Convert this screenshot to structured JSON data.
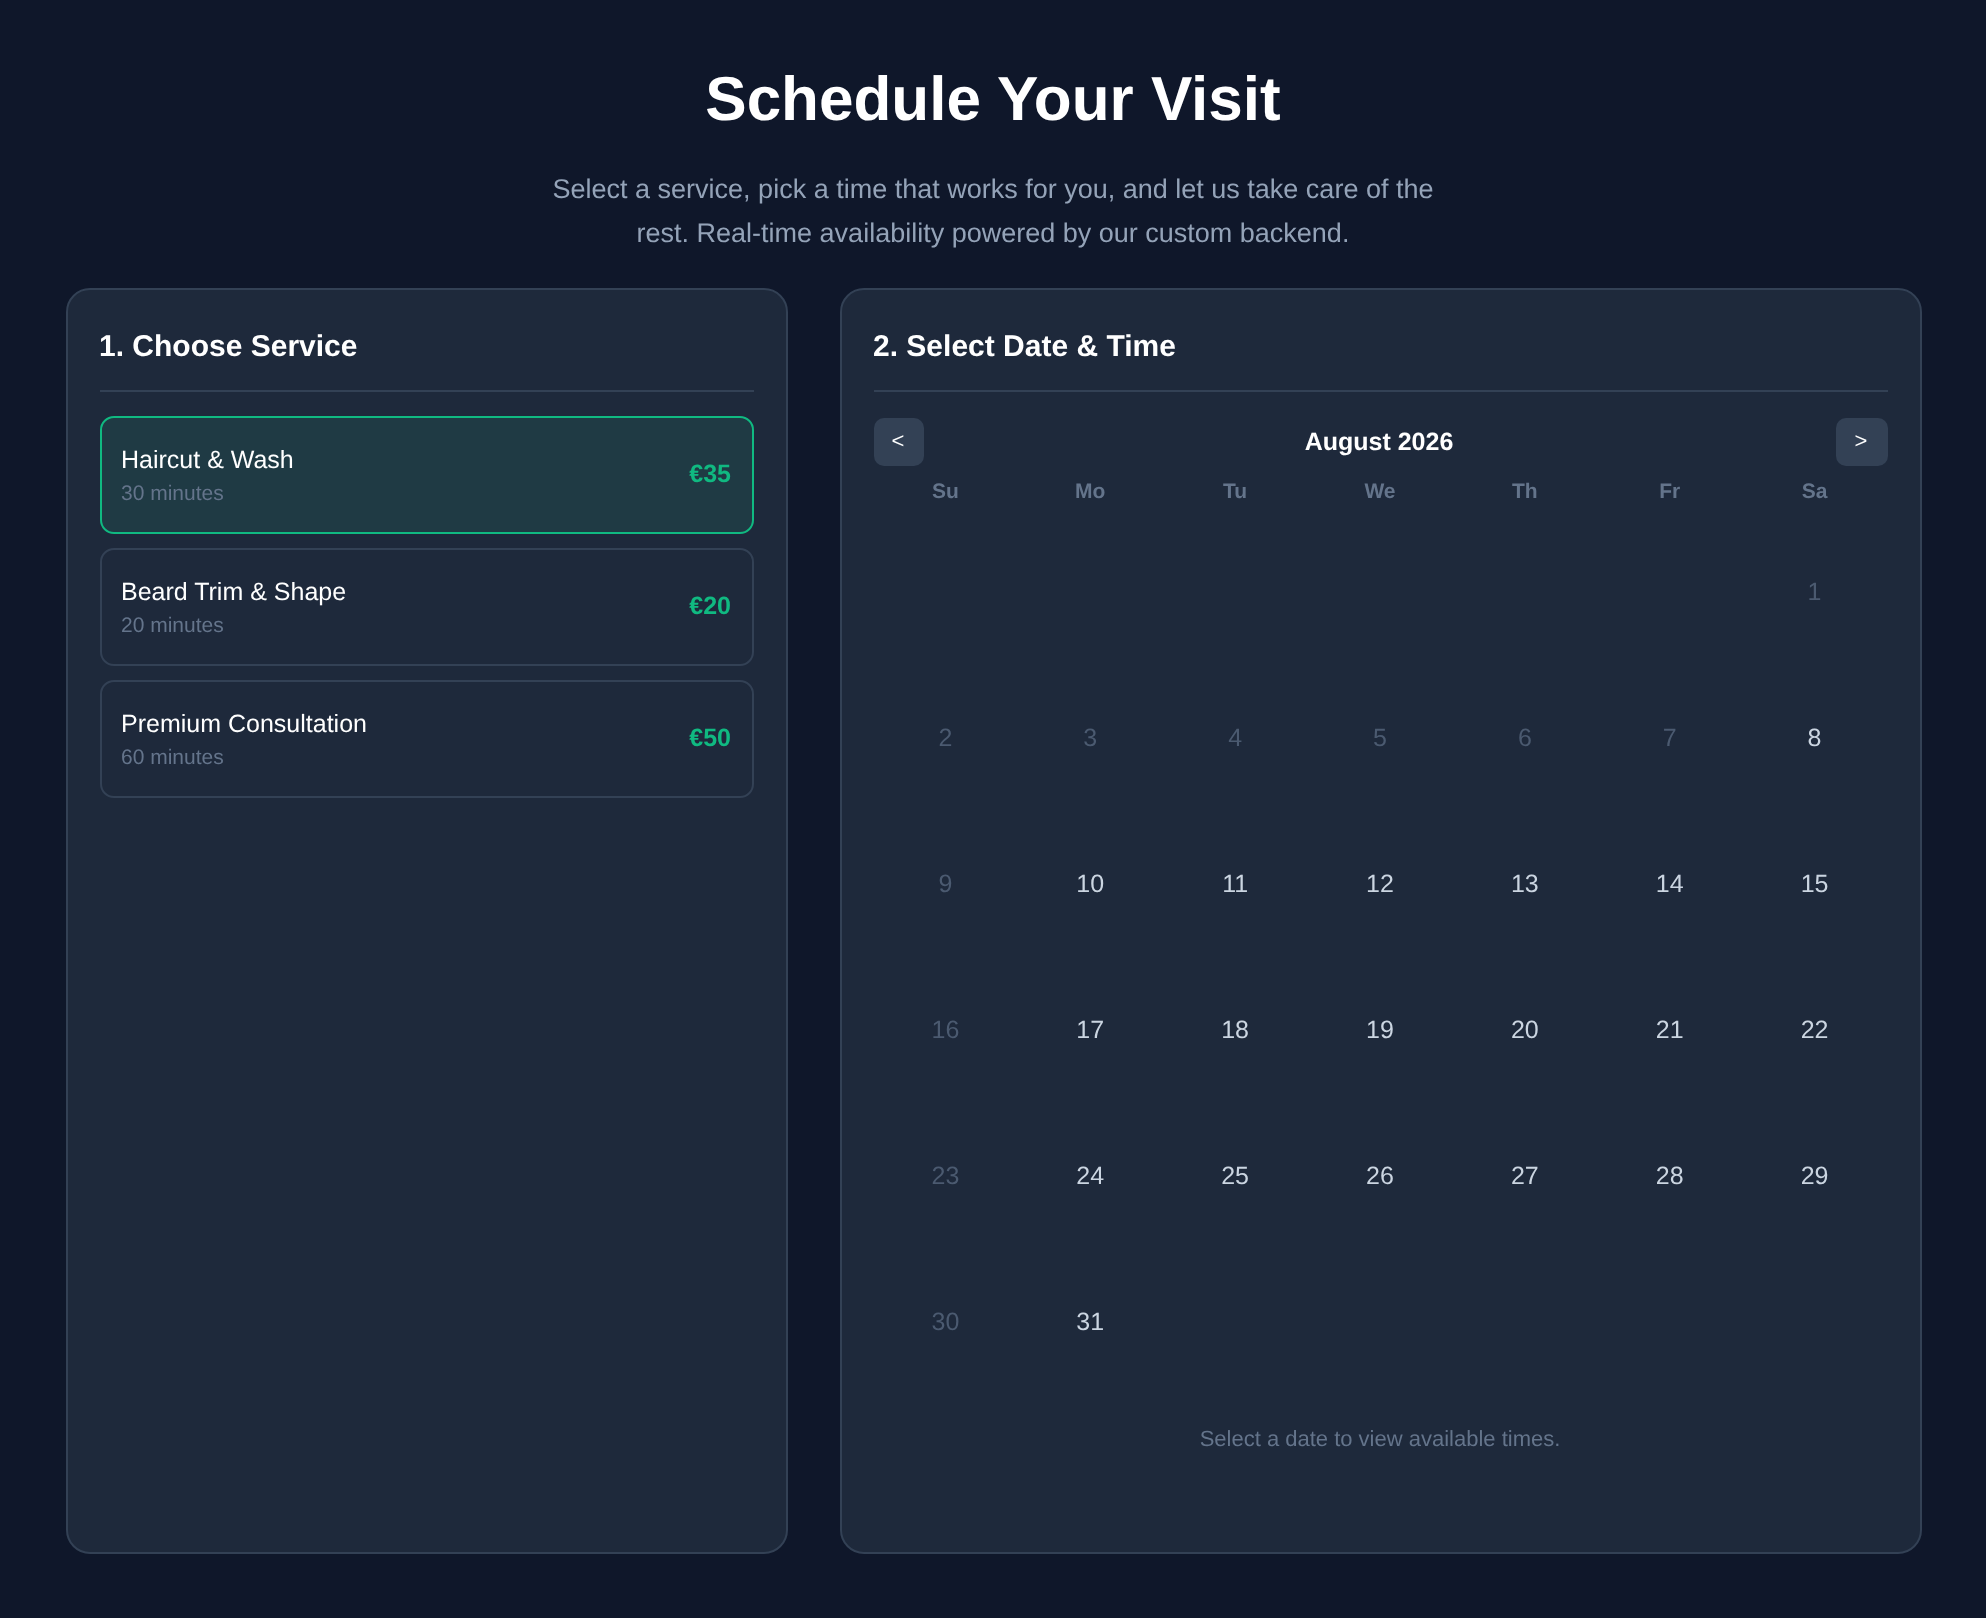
{
  "header": {
    "title": "Schedule Your Visit",
    "subtitle": "Select a service, pick a time that works for you, and let us take care of the rest. Real-time availability powered by our custom backend."
  },
  "services_panel": {
    "title": "1. Choose Service",
    "services": [
      {
        "name": "Haircut & Wash",
        "duration": "30 minutes",
        "price": "€35",
        "selected": true
      },
      {
        "name": "Beard Trim & Shape",
        "duration": "20 minutes",
        "price": "€20",
        "selected": false
      },
      {
        "name": "Premium Consultation",
        "duration": "60 minutes",
        "price": "€50",
        "selected": false
      }
    ]
  },
  "calendar_panel": {
    "title": "2. Select Date & Time",
    "prev": "<",
    "next": ">",
    "month": "August 2026",
    "weekdays": [
      "Su",
      "Mo",
      "Tu",
      "We",
      "Th",
      "Fr",
      "Sa"
    ],
    "weeks": [
      {
        "right_aligned": true,
        "days": [
          {
            "day": "1",
            "disabled": true
          }
        ]
      },
      {
        "right_aligned": false,
        "days": [
          {
            "day": "2",
            "disabled": true
          },
          {
            "day": "3",
            "disabled": true
          },
          {
            "day": "4",
            "disabled": true
          },
          {
            "day": "5",
            "disabled": true
          },
          {
            "day": "6",
            "disabled": true
          },
          {
            "day": "7",
            "disabled": true
          },
          {
            "day": "8",
            "disabled": false
          }
        ]
      },
      {
        "right_aligned": false,
        "days": [
          {
            "day": "9",
            "disabled": true
          },
          {
            "day": "10",
            "disabled": false
          },
          {
            "day": "11",
            "disabled": false
          },
          {
            "day": "12",
            "disabled": false
          },
          {
            "day": "13",
            "disabled": false
          },
          {
            "day": "14",
            "disabled": false
          },
          {
            "day": "15",
            "disabled": false
          }
        ]
      },
      {
        "right_aligned": false,
        "days": [
          {
            "day": "16",
            "disabled": true
          },
          {
            "day": "17",
            "disabled": false
          },
          {
            "day": "18",
            "disabled": false
          },
          {
            "day": "19",
            "disabled": false
          },
          {
            "day": "20",
            "disabled": false
          },
          {
            "day": "21",
            "disabled": false
          },
          {
            "day": "22",
            "disabled": false
          }
        ]
      },
      {
        "right_aligned": false,
        "days": [
          {
            "day": "23",
            "disabled": true
          },
          {
            "day": "24",
            "disabled": false
          },
          {
            "day": "25",
            "disabled": false
          },
          {
            "day": "26",
            "disabled": false
          },
          {
            "day": "27",
            "disabled": false
          },
          {
            "day": "28",
            "disabled": false
          },
          {
            "day": "29",
            "disabled": false
          }
        ]
      },
      {
        "right_aligned": false,
        "days": [
          {
            "day": "30",
            "disabled": true
          },
          {
            "day": "31",
            "disabled": false
          }
        ]
      }
    ],
    "hint": "Select a date to view available times."
  }
}
